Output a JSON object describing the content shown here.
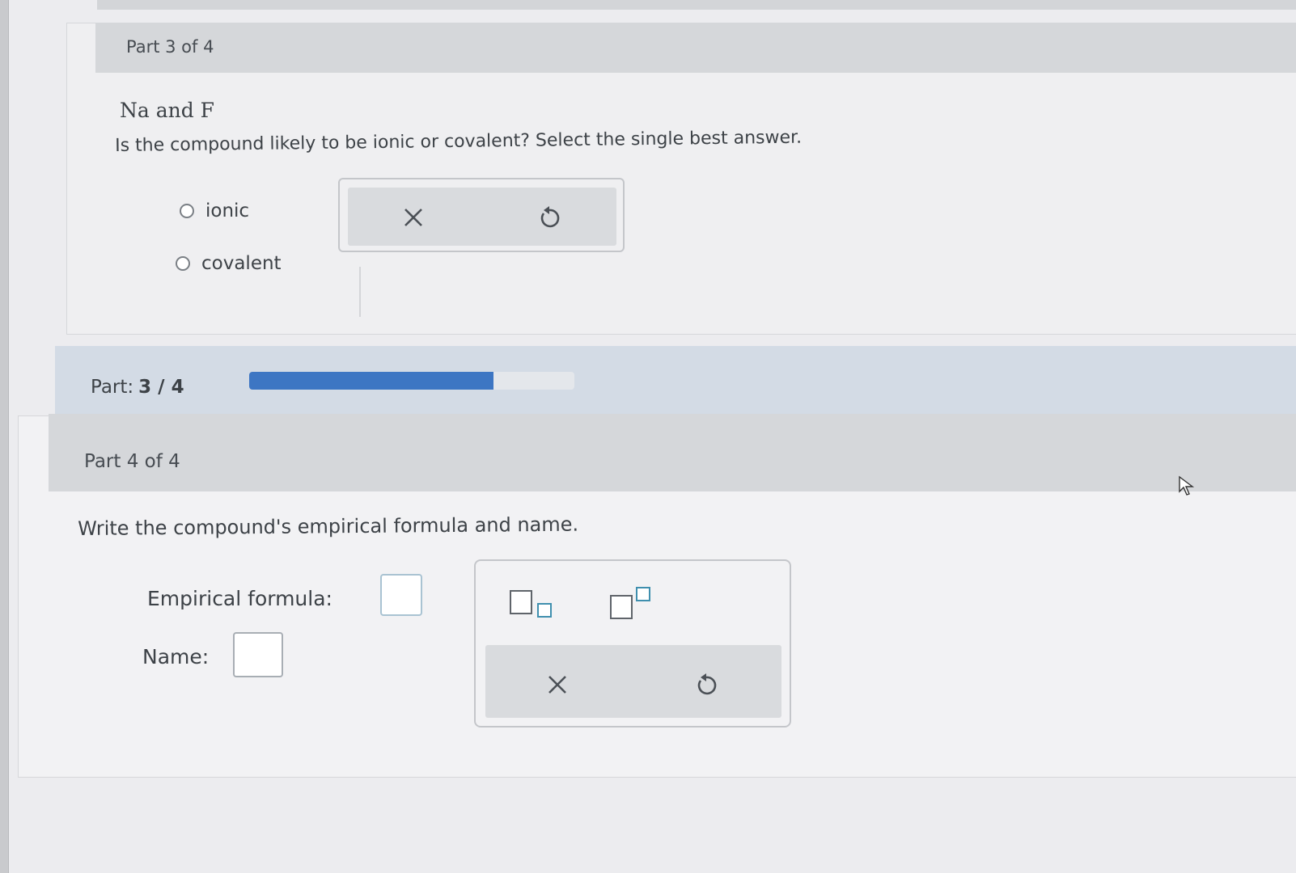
{
  "part3": {
    "header": "Part 3 of 4",
    "molecule": "Na and F",
    "question": "Is the compound likely to be ionic or covalent? Select the single best answer.",
    "options": [
      "ionic",
      "covalent"
    ],
    "tools": {
      "clear_icon": "close-icon",
      "undo_icon": "undo-icon"
    }
  },
  "progress": {
    "label": "Part:",
    "value_text": "3 / 4",
    "fraction": 0.75,
    "accent": "#3d76c3"
  },
  "part4": {
    "header": "Part 4 of 4",
    "instruction": "Write the compound's empirical formula and name.",
    "formula_label": "Empirical formula:",
    "name_label": "Name:",
    "tools": {
      "subscript_icon": "subscript-icon",
      "superscript_icon": "superscript-icon",
      "clear_icon": "close-icon",
      "undo_icon": "undo-icon"
    }
  }
}
